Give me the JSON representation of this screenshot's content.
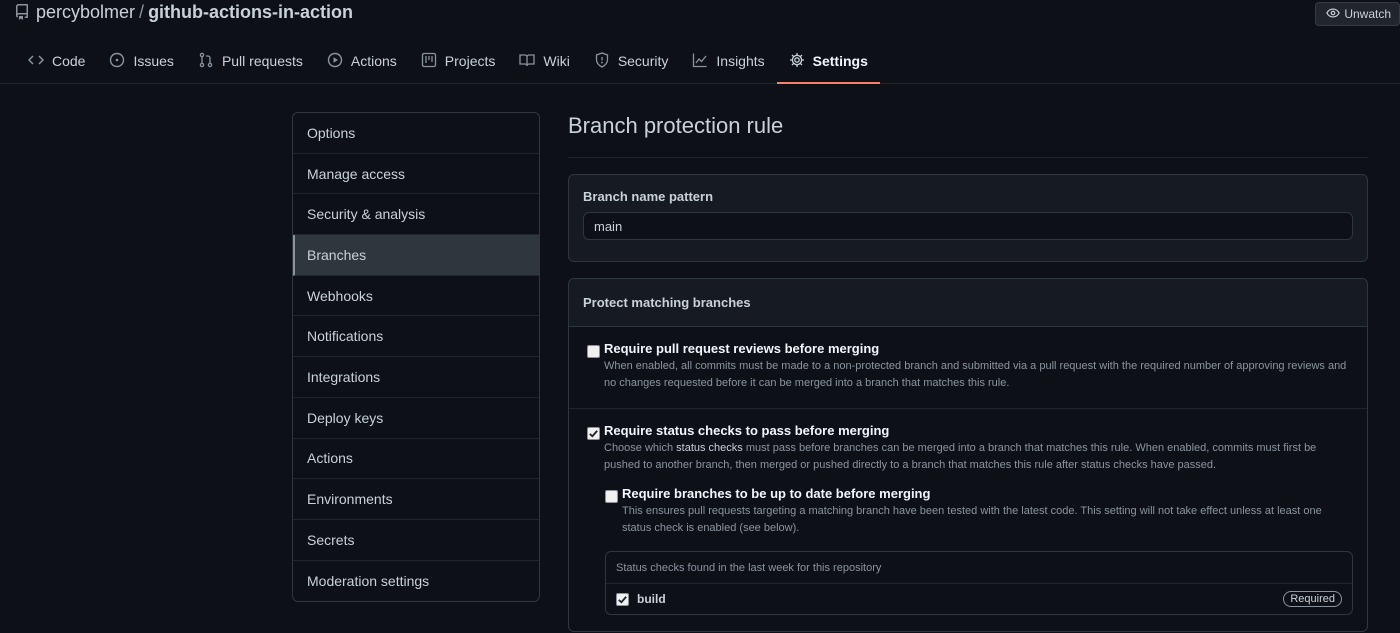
{
  "repo": {
    "owner": "percybolmer",
    "separator": "/",
    "name": "github-actions-in-action"
  },
  "watch": {
    "label": "Unwatch"
  },
  "tabs": [
    {
      "label": "Code",
      "icon": "code-icon"
    },
    {
      "label": "Issues",
      "icon": "issue-icon"
    },
    {
      "label": "Pull requests",
      "icon": "pull-request-icon"
    },
    {
      "label": "Actions",
      "icon": "play-icon"
    },
    {
      "label": "Projects",
      "icon": "project-icon"
    },
    {
      "label": "Wiki",
      "icon": "book-icon"
    },
    {
      "label": "Security",
      "icon": "shield-icon"
    },
    {
      "label": "Insights",
      "icon": "graph-icon"
    },
    {
      "label": "Settings",
      "icon": "gear-icon",
      "selected": true
    }
  ],
  "menu": [
    {
      "label": "Options"
    },
    {
      "label": "Manage access"
    },
    {
      "label": "Security & analysis"
    },
    {
      "label": "Branches",
      "selected": true
    },
    {
      "label": "Webhooks"
    },
    {
      "label": "Notifications"
    },
    {
      "label": "Integrations"
    },
    {
      "label": "Deploy keys"
    },
    {
      "label": "Actions"
    },
    {
      "label": "Environments"
    },
    {
      "label": "Secrets"
    },
    {
      "label": "Moderation settings"
    }
  ],
  "page": {
    "title": "Branch protection rule",
    "pattern_label": "Branch name pattern",
    "pattern_value": "main",
    "protect_header": "Protect matching branches"
  },
  "rules": {
    "pr_reviews": {
      "title": "Require pull request reviews before merging",
      "desc": "When enabled, all commits must be made to a non-protected branch and submitted via a pull request with the required number of approving reviews and no changes requested before it can be merged into a branch that matches this rule.",
      "checked": false
    },
    "status_checks": {
      "title": "Require status checks to pass before merging",
      "desc_pre": "Choose which ",
      "desc_em": "status checks",
      "desc_post": " must pass before branches can be merged into a branch that matches this rule. When enabled, commits must first be pushed to another branch, then merged or pushed directly to a branch that matches this rule after status checks have passed.",
      "checked": true
    },
    "up_to_date": {
      "title": "Require branches to be up to date before merging",
      "desc": "This ensures pull requests targeting a matching branch have been tested with the latest code. This setting will not take effect unless at least one status check is enabled (see below).",
      "checked": false
    }
  },
  "checks": {
    "header": "Status checks found in the last week for this repository",
    "items": [
      {
        "name": "build",
        "checked": true,
        "badge": "Required"
      }
    ]
  }
}
